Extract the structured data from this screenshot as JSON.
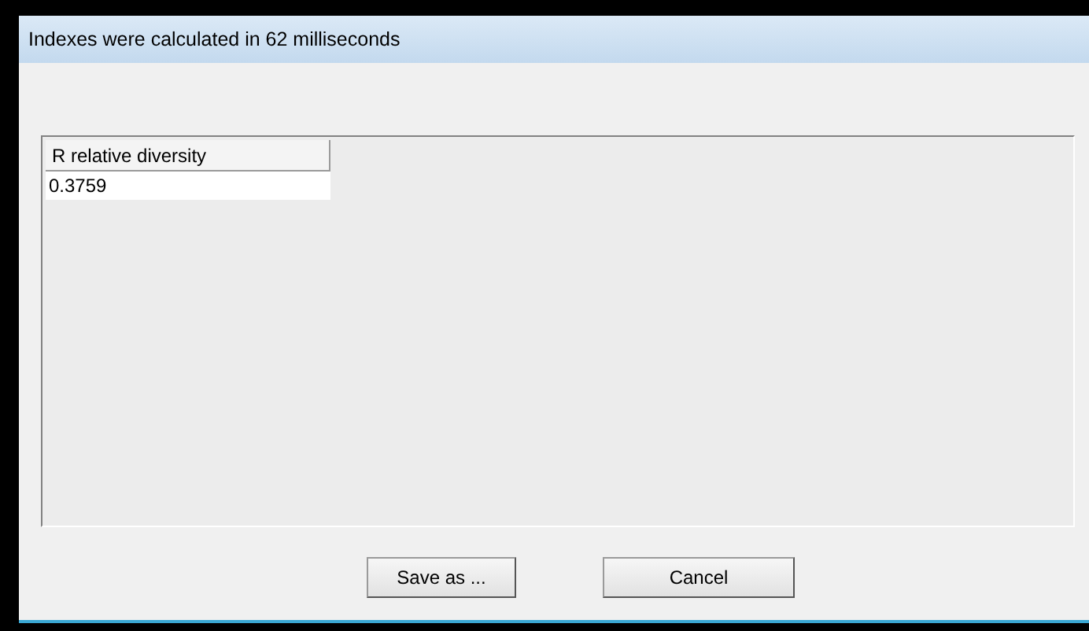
{
  "window": {
    "title": "Indexes were calculated in 62 milliseconds"
  },
  "table": {
    "columns": [
      "R relative diversity"
    ],
    "rows": [
      [
        "0.3759"
      ]
    ]
  },
  "buttons": [
    "Save as ...",
    "Cancel"
  ]
}
